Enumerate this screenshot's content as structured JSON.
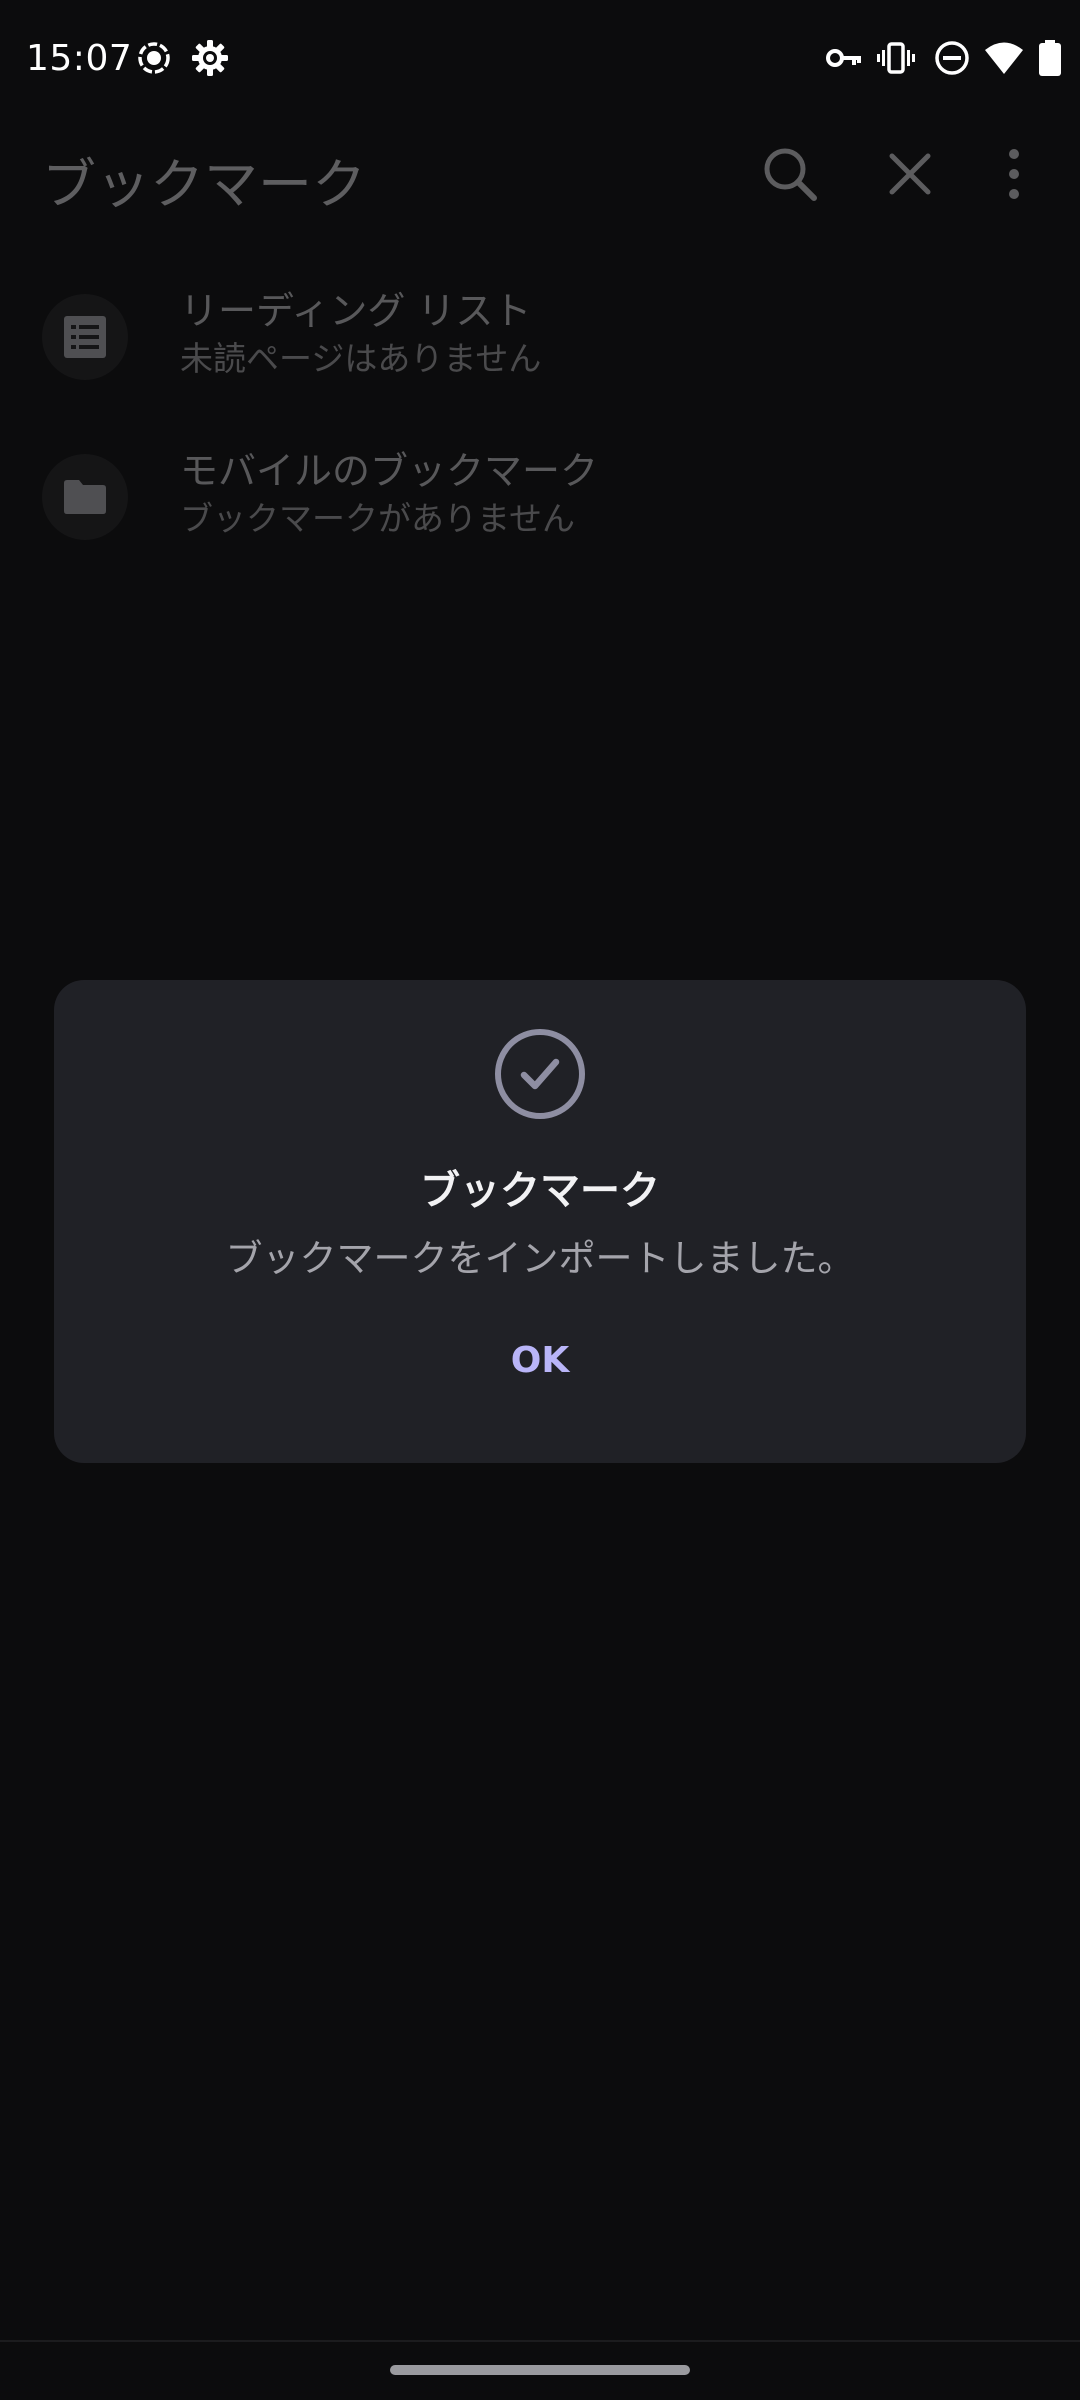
{
  "status_bar": {
    "time": "15:07",
    "left_icons": [
      "screen-record-icon",
      "settings-gear-icon"
    ],
    "right_icons": [
      "vpn-key-icon",
      "vibrate-icon",
      "do-not-disturb-icon",
      "wifi-icon",
      "battery-icon"
    ]
  },
  "app_bar": {
    "title": "ブックマーク",
    "actions": [
      "search-icon",
      "close-icon",
      "more-vert-icon"
    ]
  },
  "list": {
    "items": [
      {
        "title": "リーディング リスト",
        "subtitle": "未読ページはありません",
        "icon": "reading-list-icon"
      },
      {
        "title": "モバイルのブックマーク",
        "subtitle": "ブックマークがありません",
        "icon": "folder-icon"
      }
    ]
  },
  "dialog": {
    "icon": "check-circle-icon",
    "title": "ブックマーク",
    "message": "ブックマークをインポートしました。",
    "ok_label": "OK"
  },
  "colors": {
    "background": "#0c0c0d",
    "dialog_bg": "#202126",
    "accent": "#b9b5f8",
    "dimmed_text": "#58585a"
  }
}
